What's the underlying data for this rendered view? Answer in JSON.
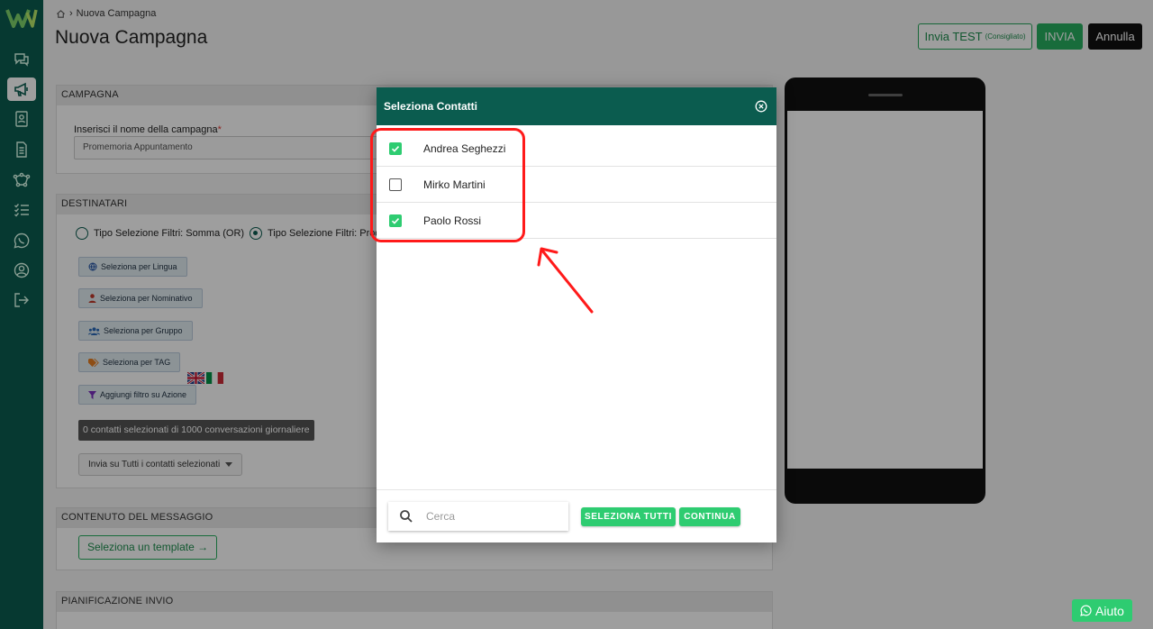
{
  "breadcrumb": {
    "current": "Nuova Campagna"
  },
  "page_title": "Nuova Campagna",
  "header_buttons": {
    "test_label": "Invia TEST",
    "test_note": "(Consigliato)",
    "send_label": "INVIA",
    "cancel_label": "Annulla"
  },
  "sidebar": {
    "icons": [
      "chat-icon",
      "megaphone-icon",
      "contacts-icon",
      "document-icon",
      "flow-icon",
      "checklist-icon",
      "whatsapp-icon",
      "user-icon",
      "logout-icon"
    ],
    "active": "megaphone-icon"
  },
  "campagna": {
    "header": "CAMPAGNA",
    "name_label": "Inserisci il nome della campagna",
    "required_mark": "*",
    "name_value": "Promemoria Appuntamento"
  },
  "destinatari": {
    "header": "DESTINATARI",
    "radio_or": "Tipo Selezione Filtri: Somma (OR)",
    "radio_and": "Tipo Selezione Filtri: Prod",
    "filters": {
      "lingua": "Seleziona per Lingua",
      "nominativo": "Seleziona per Nominativo",
      "gruppo": "Seleziona per Gruppo",
      "tag": "Seleziona per TAG",
      "azione": "Aggiungi filtro su Azione"
    },
    "count_text": "0 contatti selezionati di 1000 conversazioni giornaliere",
    "send_option": "Invia su Tutti i contatti selezionati"
  },
  "contenuto": {
    "header": "CONTENUTO DEL MESSAGGIO",
    "template_button": "Seleziona un template →"
  },
  "pianificazione": {
    "header": "PIANIFICAZIONE INVIO"
  },
  "modal": {
    "title": "Seleziona Contatti",
    "contacts": [
      {
        "name": "Andrea Seghezzi",
        "checked": true
      },
      {
        "name": "Mirko Martini",
        "checked": false
      },
      {
        "name": "Paolo Rossi",
        "checked": true
      }
    ],
    "search_placeholder": "Cerca",
    "select_all_label": "SELEZIONA TUTTI",
    "continue_label": "CONTINUA"
  },
  "help_button": "Aiuto",
  "colors": {
    "sidebar": "#0b5c4f",
    "accent_green": "#2ecc71",
    "highlight_red": "#ff1a1a"
  }
}
